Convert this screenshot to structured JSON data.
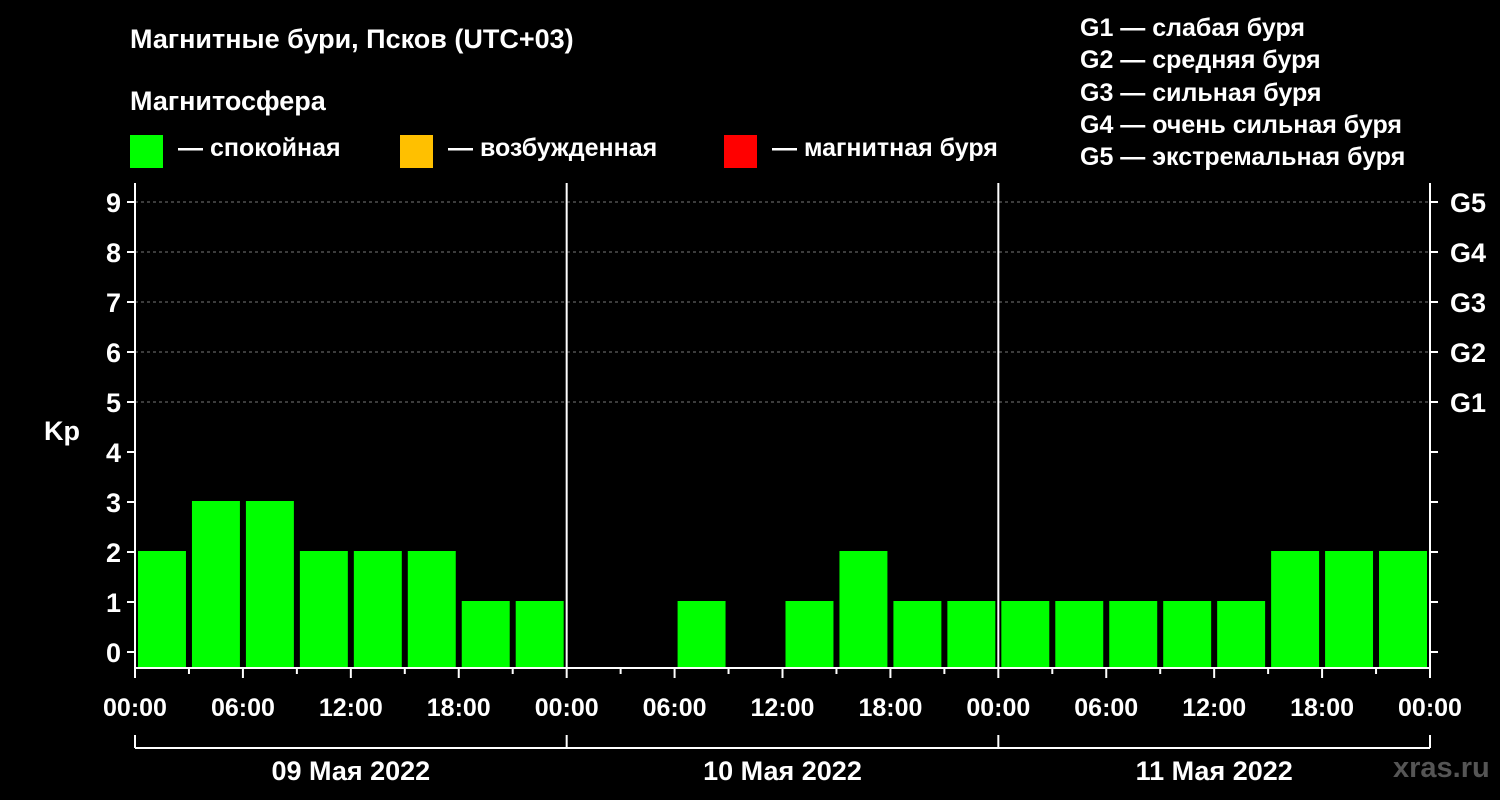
{
  "title": "Магнитные бури, Псков (UTC+03)",
  "magnetosphere": {
    "title": "Магнитосфера",
    "legend": [
      {
        "label": "— спокойная",
        "color": "#00ff00"
      },
      {
        "label": "— возбужденная",
        "color": "#ffc000"
      },
      {
        "label": "— магнитная буря",
        "color": "#ff0000"
      }
    ]
  },
  "g_scale": [
    "G1 — слабая буря",
    "G2 — средняя буря",
    "G3 — сильная буря",
    "G4 — очень сильная буря",
    "G5 — экстремальная буря"
  ],
  "watermark": "xras.ru",
  "chart_data": {
    "type": "bar",
    "ylabel": "Kp",
    "ylim": [
      0,
      9
    ],
    "y_ticks": [
      "0",
      "1",
      "2",
      "3",
      "4",
      "5",
      "6",
      "7",
      "8",
      "9"
    ],
    "right_ticks": [
      {
        "kp": 5,
        "label": "G1"
      },
      {
        "kp": 6,
        "label": "G2"
      },
      {
        "kp": 7,
        "label": "G3"
      },
      {
        "kp": 8,
        "label": "G4"
      },
      {
        "kp": 9,
        "label": "G5"
      }
    ],
    "grid": "dashed horizontal lines at Kp 5–9",
    "x_tick_labels": [
      "00:00",
      "06:00",
      "12:00",
      "18:00",
      "00:00",
      "06:00",
      "12:00",
      "18:00",
      "00:00",
      "06:00",
      "12:00",
      "18:00",
      "00:00"
    ],
    "days": [
      "09 Мая 2022",
      "10 Мая 2022",
      "11 Мая 2022"
    ],
    "interval_hours": 3,
    "values": [
      2,
      3,
      3,
      2,
      2,
      2,
      1,
      1,
      0,
      0,
      1,
      0,
      1,
      2,
      1,
      1,
      1,
      1,
      1,
      1,
      1,
      2,
      2,
      2
    ],
    "bar_color": "#00ff00"
  }
}
